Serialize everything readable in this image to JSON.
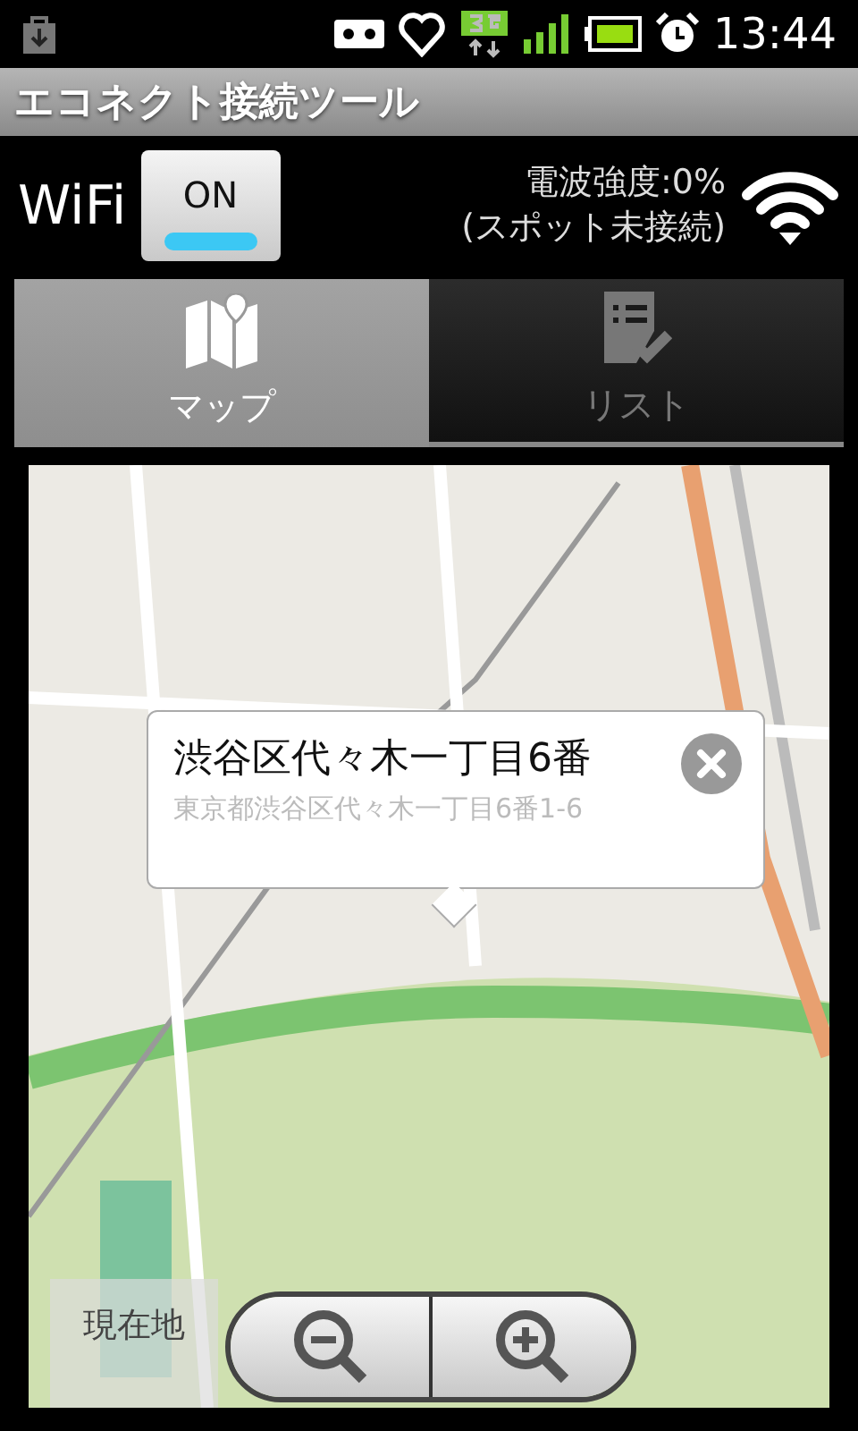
{
  "status_bar": {
    "time": "13:44"
  },
  "title": "エコネクト接続ツール",
  "wifi": {
    "label": "WiFi",
    "toggle": {
      "label": "ON",
      "on": true
    },
    "strength": "電波強度:0%",
    "spot": "(スポット未接続)"
  },
  "tabs": [
    {
      "label": "マップ",
      "kind": "map",
      "selected": true
    },
    {
      "label": "リスト",
      "kind": "list",
      "selected": false
    }
  ],
  "map": {
    "popup": {
      "title": "渋谷区代々木一丁目6番",
      "address": "東京都渋谷区代々木一丁目6番1-6"
    },
    "locate_button": "現在地"
  }
}
